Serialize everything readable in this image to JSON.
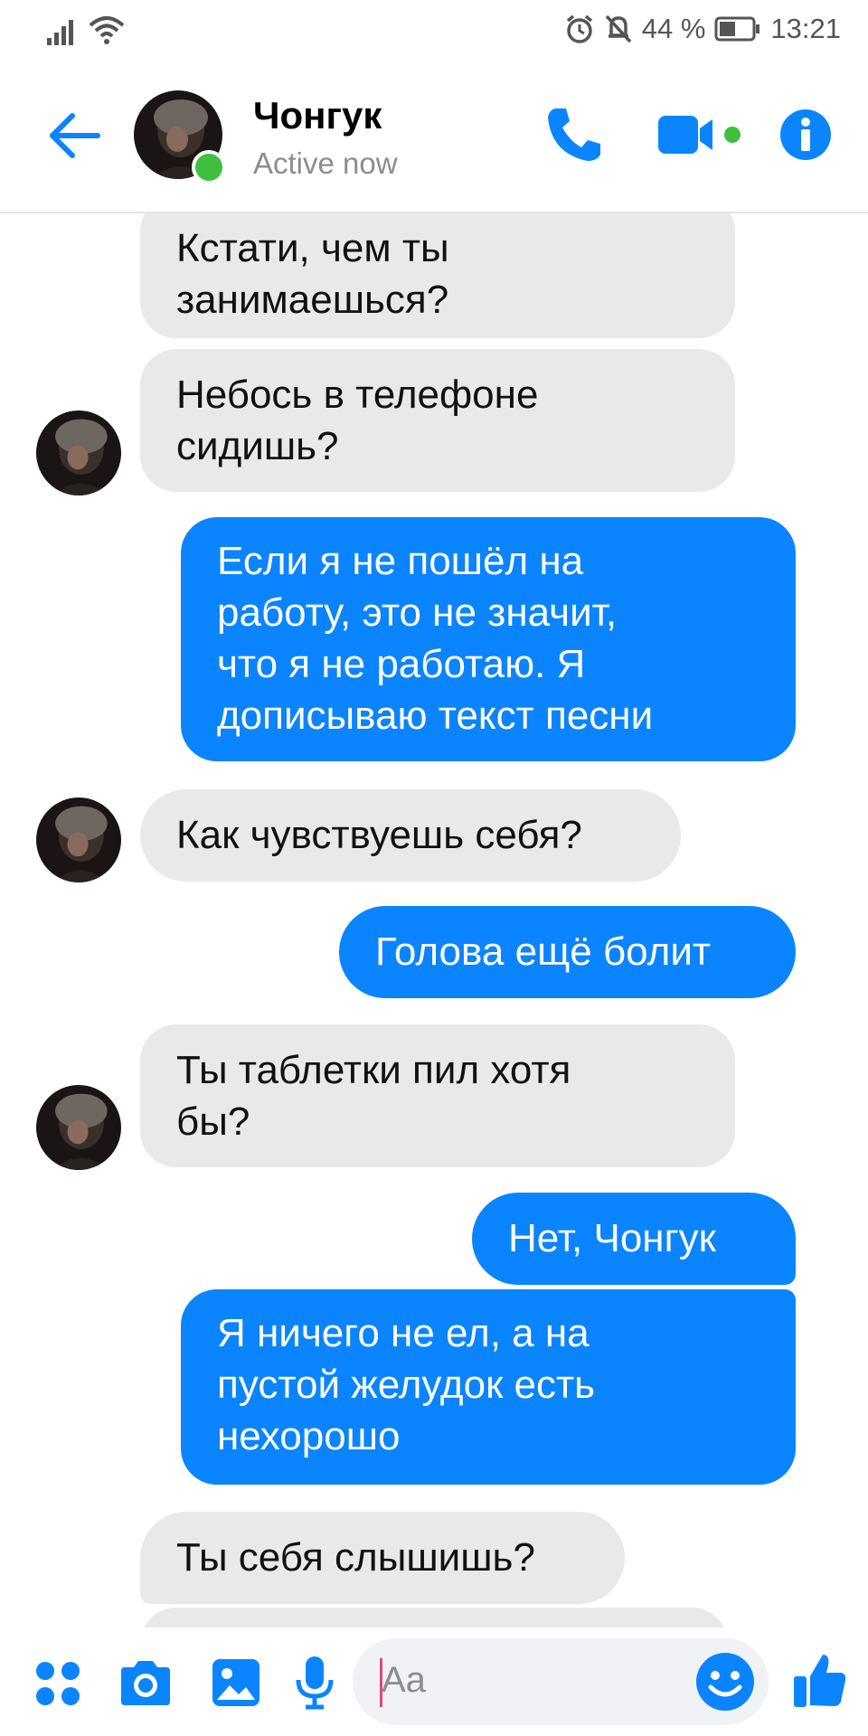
{
  "status_bar": {
    "battery_percent": "44 %",
    "time": "13:21"
  },
  "header": {
    "contact_name": "Чонгук",
    "contact_status": "Active now"
  },
  "messages": [
    {
      "from": "contact",
      "text": "Кстати, чем ты\nзанимаешься?"
    },
    {
      "from": "contact",
      "text": "Небось в телефоне\nсидишь?"
    },
    {
      "from": "me",
      "text": "Если я не пошёл на\nработу, это не значит,\nчто я не работаю. Я\nдописываю текст песни"
    },
    {
      "from": "contact",
      "text": "Как чувствуешь себя?"
    },
    {
      "from": "me",
      "text": "Голова ещё болит"
    },
    {
      "from": "contact",
      "text": "Ты таблетки пил хотя\nбы?"
    },
    {
      "from": "me",
      "text": "Нет, Чонгук"
    },
    {
      "from": "me",
      "text": "Я ничего не ел, а на\nпустой желудок есть\nнехорошо"
    },
    {
      "from": "contact",
      "text": "Ты себя слышишь?"
    }
  ],
  "composer": {
    "placeholder": "Aa"
  },
  "colors": {
    "accent": "#0a84ff",
    "incoming_bubble": "#e9e9eb",
    "online": "#3fbf3f"
  },
  "icons": [
    "back-arrow-icon",
    "phone-icon",
    "video-camera-icon",
    "info-icon",
    "menu-dots-icon",
    "camera-icon",
    "image-icon",
    "microphone-icon",
    "emoji-icon",
    "thumbs-up-icon"
  ]
}
